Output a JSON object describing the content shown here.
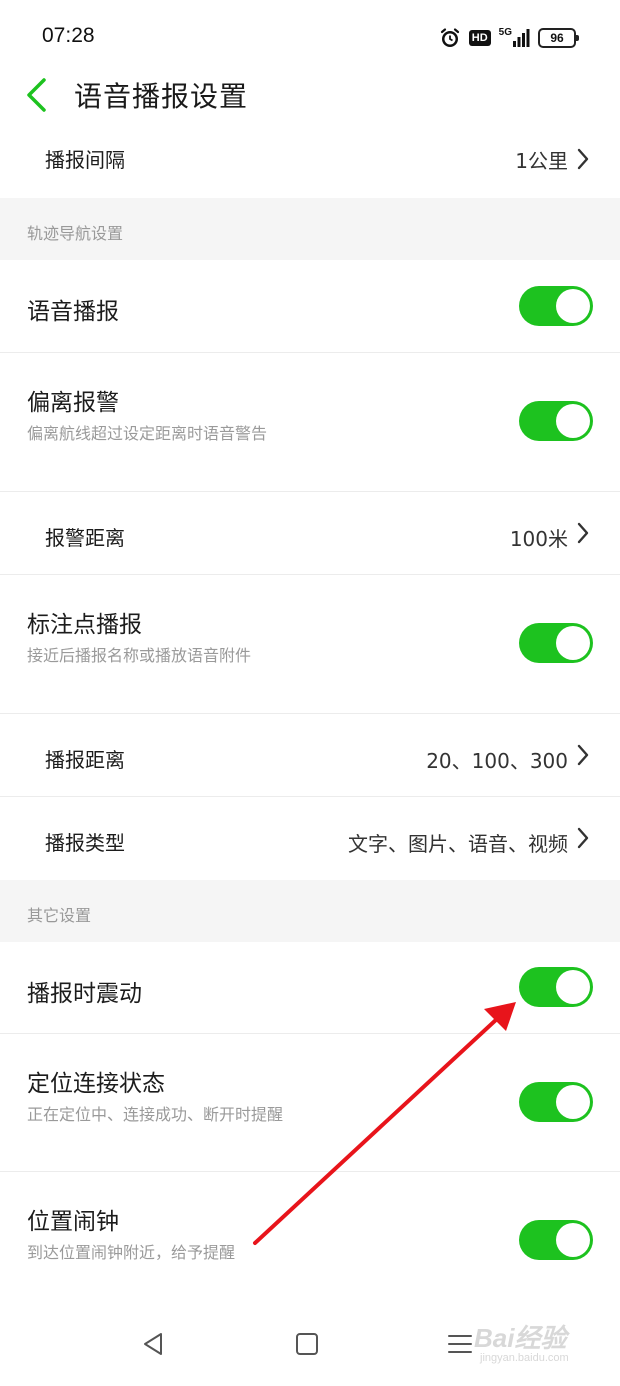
{
  "status_bar": {
    "time": "07:28",
    "network": "5G",
    "hd": "HD",
    "battery": "96",
    "icons": [
      "alarm-icon",
      "hd-icon",
      "signal-icon",
      "battery-icon"
    ]
  },
  "header": {
    "title": "语音播报设置",
    "back_icon": "chevron-left-icon"
  },
  "rows": {
    "interval": {
      "label": "播报间隔",
      "value": "1公里"
    },
    "section_track": "轨迹导航设置",
    "voice": {
      "label": "语音播报",
      "on": true
    },
    "deviation": {
      "label": "偏离报警",
      "sub": "偏离航线超过设定距离时语音警告",
      "on": true
    },
    "alarm_distance": {
      "label": "报警距离",
      "value": "100米"
    },
    "waypoint": {
      "label": "标注点播报",
      "sub": "接近后播报名称或播放语音附件",
      "on": true
    },
    "broadcast_distance": {
      "label": "播报距离",
      "value": "20、100、300"
    },
    "broadcast_type": {
      "label": "播报类型",
      "value": "文字、图片、语音、视频"
    },
    "section_other": "其它设置",
    "vibrate": {
      "label": "播报时震动",
      "on": true
    },
    "location_status": {
      "label": "定位连接状态",
      "sub": "正在定位中、连接成功、断开时提醒",
      "on": true
    },
    "location_alarm": {
      "label": "位置闹钟",
      "sub": "到达位置闹钟附近，给予提醒",
      "on": true
    }
  },
  "nav": {
    "icons": [
      "back-triangle-icon",
      "home-square-icon",
      "menu-lines-icon"
    ]
  },
  "watermark": {
    "text": "Bai经验",
    "sub": "jingyan.baidu.com"
  },
  "colors": {
    "accent": "#1dc21f",
    "annotation_arrow": "#e8141b"
  }
}
